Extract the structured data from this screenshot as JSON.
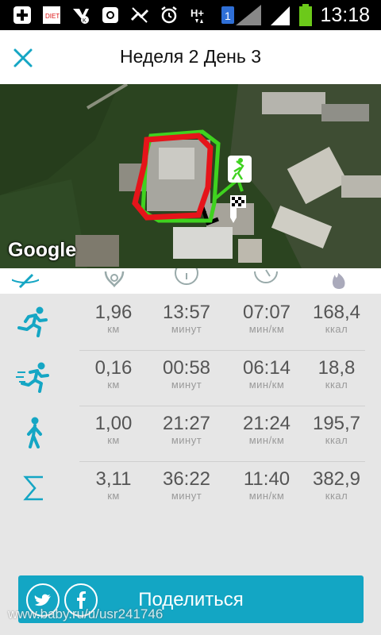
{
  "status_bar": {
    "time": "13:18",
    "icons": [
      "add-icon",
      "diet-app-icon",
      "vk-icon",
      "instagram-icon",
      "signal-off-icon",
      "alarm-icon",
      "hplus-data-icon",
      "sim-1-icon",
      "signal-bars-icon",
      "battery-icon"
    ]
  },
  "header": {
    "title": "Неделя 2 День 3",
    "close_icon": "close-icon"
  },
  "map": {
    "attribution": "Google"
  },
  "tabs": [
    "edit-icon",
    "heart-rate-icon",
    "timer-icon",
    "speedometer-icon",
    "calories-flame-icon"
  ],
  "stats": [
    {
      "icon": "run-icon",
      "values": [
        {
          "v": "1,96",
          "u": "км"
        },
        {
          "v": "13:57",
          "u": "минут"
        },
        {
          "v": "07:07",
          "u": "мин/км"
        },
        {
          "v": "168,4",
          "u": "ккал"
        }
      ]
    },
    {
      "icon": "sprint-icon",
      "values": [
        {
          "v": "0,16",
          "u": "км"
        },
        {
          "v": "00:58",
          "u": "минут"
        },
        {
          "v": "06:14",
          "u": "мин/км"
        },
        {
          "v": "18,8",
          "u": "ккал"
        }
      ]
    },
    {
      "icon": "walk-icon",
      "values": [
        {
          "v": "1,00",
          "u": "км"
        },
        {
          "v": "21:27",
          "u": "минут"
        },
        {
          "v": "21:24",
          "u": "мин/км"
        },
        {
          "v": "195,7",
          "u": "ккал"
        }
      ]
    },
    {
      "icon": "sum-icon",
      "values": [
        {
          "v": "3,11",
          "u": "км"
        },
        {
          "v": "36:22",
          "u": "минут"
        },
        {
          "v": "11:40",
          "u": "мин/км"
        },
        {
          "v": "382,9",
          "u": "ккал"
        }
      ]
    }
  ],
  "share": {
    "label": "Поделиться",
    "watermark": "www.baby.ru/u/usr241746"
  },
  "colors": {
    "accent": "#13a6c4",
    "route_red": "#e5141a",
    "route_green": "#3fd21f"
  }
}
